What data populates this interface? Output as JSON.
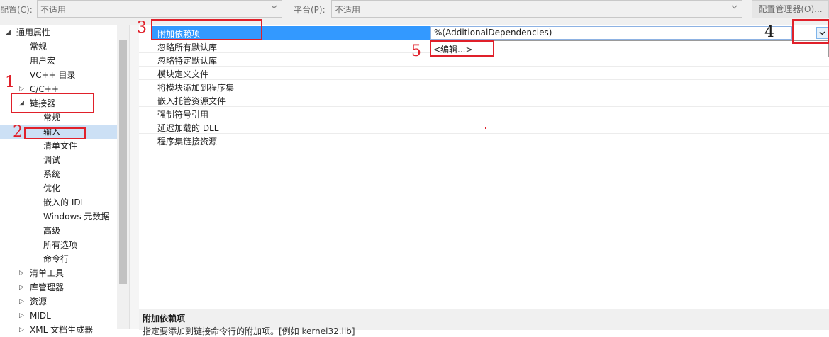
{
  "toolbar": {
    "config_label": "配置(C):",
    "config_value": "不适用",
    "platform_label": "平台(P):",
    "platform_value": "不适用",
    "config_manager_button": "配置管理器(O)..."
  },
  "tree": {
    "items": [
      {
        "label": "通用属性",
        "glyph": "◢"
      },
      {
        "label": "常规"
      },
      {
        "label": "用户宏"
      },
      {
        "label": "VC++ 目录"
      },
      {
        "label": "C/C++",
        "glyph": "▷"
      },
      {
        "label": "链接器",
        "glyph": "◢"
      },
      {
        "label": "常规"
      },
      {
        "label": "输入"
      },
      {
        "label": "清单文件"
      },
      {
        "label": "调试"
      },
      {
        "label": "系统"
      },
      {
        "label": "优化"
      },
      {
        "label": "嵌入的 IDL"
      },
      {
        "label": "Windows 元数据"
      },
      {
        "label": "高级"
      },
      {
        "label": "所有选项"
      },
      {
        "label": "命令行"
      },
      {
        "label": "清单工具",
        "glyph": "▷"
      },
      {
        "label": "库管理器",
        "glyph": "▷"
      },
      {
        "label": "资源",
        "glyph": "▷"
      },
      {
        "label": "MIDL",
        "glyph": "▷"
      },
      {
        "label": "XML 文档生成器",
        "glyph": "▷"
      }
    ]
  },
  "grid": {
    "selected_name": "附加依赖项",
    "selected_value": "%(AdditionalDependencies)",
    "dropdown_option": "<编辑...>",
    "rows": [
      {
        "name": "忽略所有默认库"
      },
      {
        "name": "忽略特定默认库"
      },
      {
        "name": "模块定义文件"
      },
      {
        "name": "将模块添加到程序集"
      },
      {
        "name": "嵌入托管资源文件"
      },
      {
        "name": "强制符号引用"
      },
      {
        "name": "延迟加载的 DLL"
      },
      {
        "name": "程序集链接资源"
      }
    ]
  },
  "description": {
    "title": "附加依赖项",
    "text": "指定要添加到链接命令行的附加项。[例如 kernel32.lib]"
  },
  "annotations": {
    "n1": "1",
    "n2": "2",
    "n3": "3",
    "n4": "4",
    "n5": "5"
  },
  "colors": {
    "selection": "#3399ff",
    "annotation": "#e0202a"
  }
}
